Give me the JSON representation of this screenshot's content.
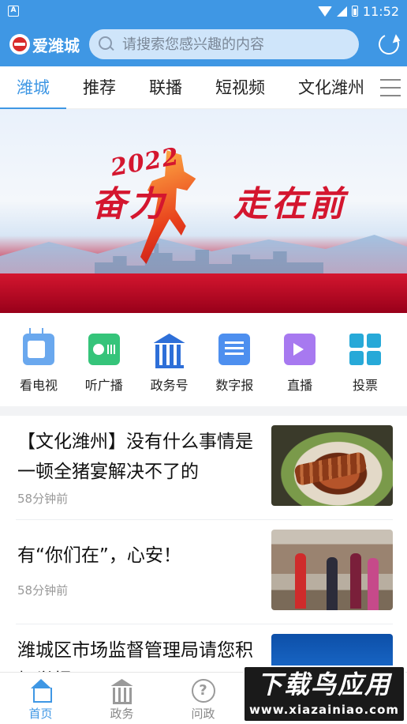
{
  "status_bar": {
    "left_icon_letter": "A",
    "time": "11:52",
    "icons": [
      "wifi-icon",
      "signal-icon",
      "battery-icon"
    ]
  },
  "header": {
    "logo_text": "爱潍城",
    "search_placeholder": "请搜索您感兴趣的内容",
    "refresh_icon": "refresh-icon",
    "brand_color": "#3f97e4"
  },
  "tabs": {
    "items": [
      "潍城",
      "推荐",
      "联播",
      "短视频",
      "文化潍州"
    ],
    "active_index": 0,
    "menu_icon": "menu-icon"
  },
  "banner": {
    "year_text": "2022",
    "slogan_part1": "奋力",
    "slogan_part2": "走在",
    "slogan_part3": "前"
  },
  "quick_access": [
    {
      "label": "看电视",
      "icon": "tv-icon"
    },
    {
      "label": "听广播",
      "icon": "radio-icon"
    },
    {
      "label": "政务号",
      "icon": "government-icon"
    },
    {
      "label": "数字报",
      "icon": "newspaper-icon"
    },
    {
      "label": "直播",
      "icon": "live-video-icon"
    },
    {
      "label": "投票",
      "icon": "vote-grid-icon"
    }
  ],
  "news": [
    {
      "title": "【文化潍州】没有什么事情是一顿全猪宴解决不了的",
      "time": "58分钟前"
    },
    {
      "title": "有“你们在”，心安！",
      "time": "58分钟前"
    },
    {
      "title": "潍城区市场监督管理局请您积极举报",
      "time": ""
    }
  ],
  "bottom_nav": [
    {
      "label": "首页",
      "icon": "home-icon",
      "active": true
    },
    {
      "label": "政务",
      "icon": "government-icon",
      "active": false
    },
    {
      "label": "问政",
      "icon": "question-icon",
      "active": false
    }
  ],
  "watermark": {
    "main": "下载鸟应用",
    "url": "www.xiazainiao.com"
  }
}
